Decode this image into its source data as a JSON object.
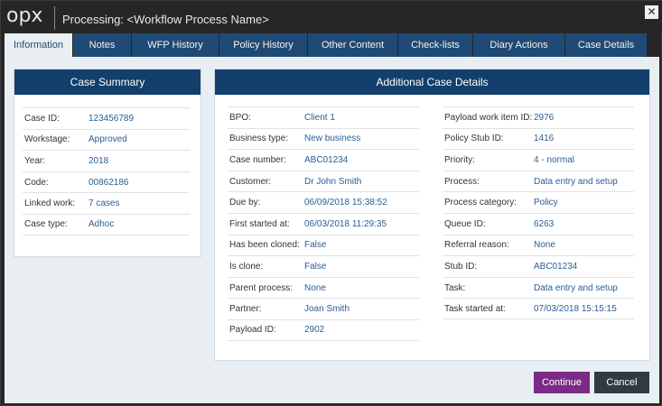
{
  "app": {
    "logo": "opx",
    "title": "Processing: <Workflow Process Name>",
    "close_glyph": "✕"
  },
  "tabs": [
    {
      "label": "Information",
      "active": true
    },
    {
      "label": "Notes"
    },
    {
      "label": "WFP History"
    },
    {
      "label": "Policy History"
    },
    {
      "label": "Other Content"
    },
    {
      "label": "Check-lists"
    },
    {
      "label": "Diary Actions"
    },
    {
      "label": "Case Details"
    }
  ],
  "case_summary": {
    "title": "Case Summary",
    "rows": [
      {
        "label": "Case ID:",
        "value": "123456789"
      },
      {
        "label": "Workstage:",
        "value": "Approved"
      },
      {
        "label": "Year:",
        "value": "2018"
      },
      {
        "label": "Code:",
        "value": "00862186"
      },
      {
        "label": "Linked work:",
        "value": "7 cases"
      },
      {
        "label": "Case type:",
        "value": "Adhoc"
      }
    ]
  },
  "additional": {
    "title": "Additional Case Details",
    "left": [
      {
        "label": "BPO:",
        "value": "Client 1"
      },
      {
        "label": "Business type:",
        "value": "New business"
      },
      {
        "label": "Case number:",
        "value": "ABC01234"
      },
      {
        "label": "Customer:",
        "value": "Dr John Smith"
      },
      {
        "label": "Due by:",
        "value": "06/09/2018 15:38:52"
      },
      {
        "label": "First started at:",
        "value": "06/03/2018 11:29:35"
      },
      {
        "label": "Has been cloned:",
        "value": "False"
      },
      {
        "label": "Is clone:",
        "value": "False"
      },
      {
        "label": "Parent process:",
        "value": "None"
      },
      {
        "label": "Partner:",
        "value": "Joan Smith"
      },
      {
        "label": "Payload ID:",
        "value": "2902"
      }
    ],
    "right": [
      {
        "label": "Payload work item ID:",
        "value": "2976"
      },
      {
        "label": "Policy Stub ID:",
        "value": "1416"
      },
      {
        "label": "Priority:",
        "value": "4 - normal"
      },
      {
        "label": "Process:",
        "value": "Data entry and setup"
      },
      {
        "label": "Process category:",
        "value": "Policy"
      },
      {
        "label": "Queue ID:",
        "value": "6263"
      },
      {
        "label": "Referral reason:",
        "value": "None"
      },
      {
        "label": "Stub ID:",
        "value": "ABC01234"
      },
      {
        "label": "Task:",
        "value": "Data entry and setup"
      },
      {
        "label": "Task started at:",
        "value": "07/03/2018 15:15:15"
      }
    ]
  },
  "actions": {
    "continue_label": "Continue",
    "cancel_label": "Cancel"
  },
  "colors": {
    "header_blue": "#123f6b",
    "tab_blue": "#1f4a75",
    "value_blue": "#2a5d96",
    "continue_purple": "#7b2a86",
    "cancel_dark": "#2f3a42"
  }
}
